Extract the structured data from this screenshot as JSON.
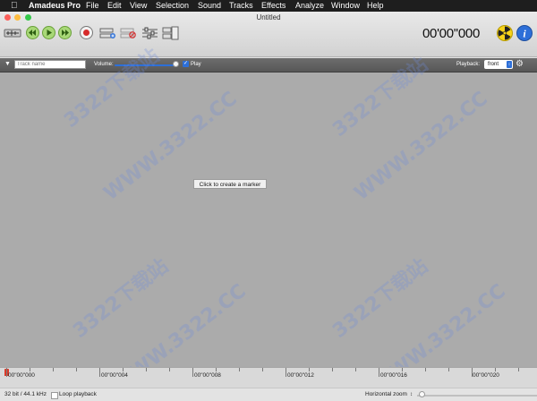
{
  "menubar": {
    "items": [
      "Amadeus Pro",
      "File",
      "Edit",
      "View",
      "Selection",
      "Sound",
      "Tracks",
      "Effects",
      "Analyze",
      "Window",
      "Help"
    ]
  },
  "window": {
    "title": "Untitled",
    "traffic_colors": [
      "#fc605b",
      "#fdbc40",
      "#34c84a"
    ]
  },
  "toolbar": {
    "time_display": "00'00''000",
    "buttons": [
      "record-setup-icon",
      "rewind-icon",
      "play-icon",
      "fast-forward-icon",
      "record-icon",
      "insert-track-icon",
      "delete-track-icon",
      "mixer-icon",
      "split-icon",
      "radiation-icon",
      "info-icon"
    ]
  },
  "track_bar": {
    "track_name_placeholder": "Track name",
    "volume_label": "Volume:",
    "volume_level": 0.95,
    "play_checked": true,
    "play_label": "Play",
    "playback_label": "Playback:",
    "playback_value": "front"
  },
  "canvas": {
    "marker_tooltip": "Click to create a marker"
  },
  "watermark": "3322下载站",
  "watermark_url": "WWW.3322.CC",
  "timeline": {
    "labels": [
      "00\"00\"000",
      "00\"00\"004",
      "00\"00\"008",
      "00\"00\"012",
      "00\"00\"016",
      "00\"00\"020"
    ]
  },
  "statusbar": {
    "format": "32 bit / 44.1 kHz",
    "loop_label": "Loop playback",
    "loop_checked": false,
    "zoom_label": "Horizontal zoom",
    "zoom_level": 0.02
  },
  "colors": {
    "accent": "#2d6fd8",
    "canvas": "#ababab",
    "record": "#d62a2a",
    "transport_green": "#7cc242"
  }
}
